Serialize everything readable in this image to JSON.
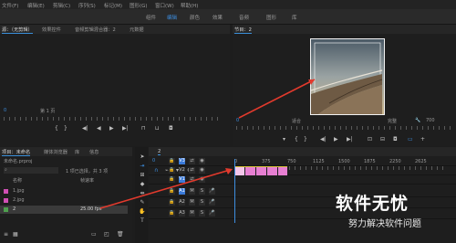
{
  "menu": [
    "文件(F)",
    "编辑(E)",
    "剪辑(C)",
    "序列(S)",
    "标记(M)",
    "图形(G)",
    "窗口(W)",
    "帮助(H)"
  ],
  "workspace_tabs": [
    "组件",
    "编辑",
    "颜色",
    "效果",
    "音频",
    "图形",
    "库"
  ],
  "source_panel": {
    "tabs": [
      "源：（无剪辑）",
      "效果控件",
      "音频剪辑混合器：2",
      "元数据"
    ],
    "timecode_left": "0",
    "fit_label": "第 1 页"
  },
  "program_panel": {
    "tab": "节目：2",
    "timecode_left": "0",
    "fit": "适合",
    "quality": "完整",
    "timecode_right": "700"
  },
  "project_panel": {
    "tabs": [
      "项目：未命名",
      "媒体浏览器",
      "库",
      "信息"
    ],
    "project_file": "未命名.prproj",
    "search_placeholder": "",
    "item_count": "1 项已选择，共 3 项",
    "headers": [
      "名称",
      "帧速率"
    ],
    "items": [
      {
        "name": "1.jpg",
        "rate": "",
        "color": "#d04fb4"
      },
      {
        "name": "2.jpg",
        "rate": "",
        "color": "#d04fb4"
      },
      {
        "name": "2",
        "rate": "25.00 fps",
        "color": "#4ea04e"
      }
    ]
  },
  "timeline": {
    "tab": "2",
    "timecode": "0",
    "ruler_labels": [
      "0",
      "375",
      "750",
      "1125",
      "1500",
      "1875",
      "2250",
      "2625"
    ],
    "video_tracks": [
      "V3",
      "V2",
      "V1"
    ],
    "audio_tracks": [
      "A1",
      "A2",
      "A3"
    ],
    "clips_count": 5
  },
  "watermark": {
    "title": "软件无忧",
    "subtitle": "努力解决软件问题"
  }
}
